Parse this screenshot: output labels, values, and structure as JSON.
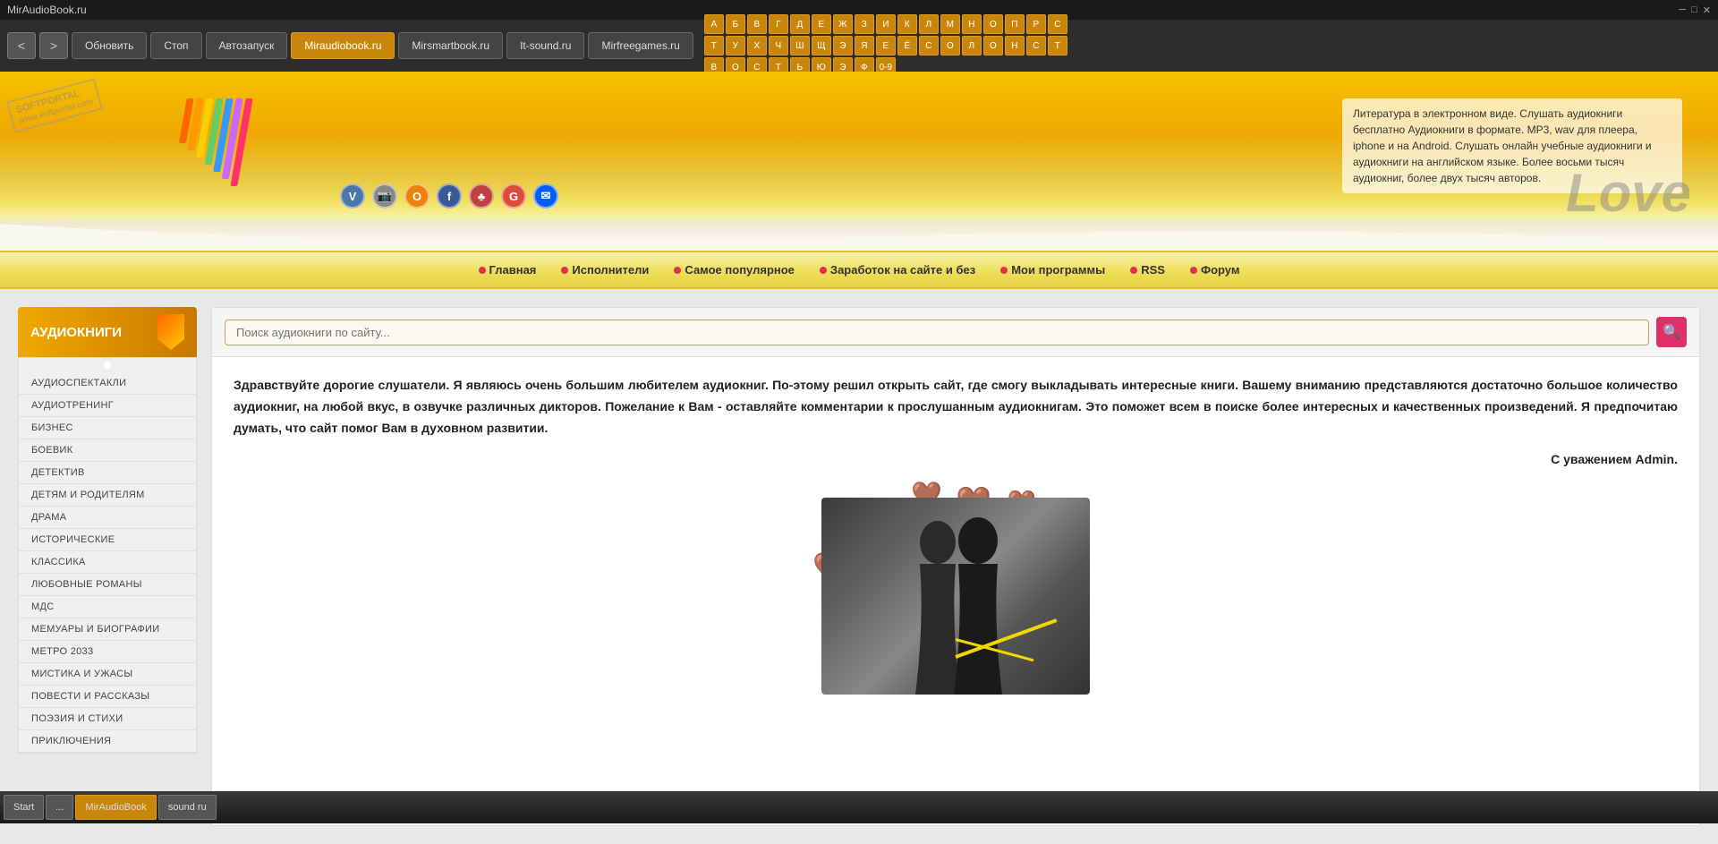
{
  "titleBar": {
    "title": "MirAudioBook.ru",
    "controls": [
      "─",
      "□",
      "✕"
    ]
  },
  "toolbar": {
    "backBtn": "<",
    "forwardBtn": ">",
    "refreshBtn": "Обновить",
    "stopBtn": "Стоп",
    "autorunBtn": "Автозапуск",
    "tabs": [
      {
        "label": "Miraudiobook.ru",
        "active": true
      },
      {
        "label": "Mirsmartbook.ru",
        "active": false
      },
      {
        "label": "It-sound.ru",
        "active": false
      },
      {
        "label": "Mirfreegames.ru",
        "active": false
      }
    ],
    "alphabet": [
      "А",
      "Б",
      "В",
      "Г",
      "Д",
      "Е",
      "Ж",
      "З",
      "И",
      "К",
      "Л",
      "М",
      "Н",
      "О",
      "П",
      "Р",
      "С",
      "Т",
      "У",
      "Х",
      "Ч",
      "Ш",
      "Щ",
      "Э",
      "Я",
      "Е",
      "Ё",
      "С",
      "О",
      "Л",
      "О",
      "Н",
      "С",
      "Т",
      "В",
      "О",
      "С",
      "Т",
      "Ь",
      "Ю",
      "Э",
      "Ф",
      "0-9"
    ]
  },
  "header": {
    "softportalText": "SOFTPORTAL\nwww.softportal.com",
    "descriptionText": "Литература в электронном виде. Слушать аудиокниги бесплатно Аудиокниги в формате. MP3, wav для плеера, iphone и на Android. Слушать онлайн учебные аудиокниги и аудиокниги на английском языке. Более восьми тысяч аудиокниг, более двух тысяч авторов.",
    "loveText": "Love",
    "socialIcons": [
      {
        "name": "vk",
        "color": "#4a76a8",
        "symbol": "V"
      },
      {
        "name": "camera",
        "color": "#888",
        "symbol": "📷"
      },
      {
        "name": "odnoklassniki",
        "color": "#ee8208",
        "symbol": "О"
      },
      {
        "name": "facebook",
        "color": "#3b5998",
        "symbol": "f"
      },
      {
        "name": "livejournal",
        "color": "#c04040",
        "symbol": "♣"
      },
      {
        "name": "google",
        "color": "#dd4b39",
        "symbol": "G"
      },
      {
        "name": "mail",
        "color": "#005ff9",
        "symbol": "✉"
      }
    ]
  },
  "navMenu": {
    "items": [
      "Главная",
      "Исполнители",
      "Самое популярное",
      "Заработок на сайте и без",
      "Мои программы",
      "RSS",
      "Форум"
    ]
  },
  "sidebar": {
    "headerLabel": "АУДИОКНИГИ",
    "items": [
      "АУДИОСПЕКТАКЛИ",
      "АУДИОТРЕНИНГ",
      "БИЗНЕС",
      "БОЕВИК",
      "ДЕТЕКТИВ",
      "ДЕТЯМ И РОДИТЕЛЯМ",
      "ДРАМА",
      "ИСТОРИЧЕСКИЕ",
      "КЛАССИКА",
      "ЛЮБОВНЫЕ РОМАНЫ",
      "МДС",
      "МЕМУАРЫ И БИОГРАФИИ",
      "МЕТРО 2033",
      "МИСТИКА И УЖАСЫ",
      "ПОВЕСТИ И РАССКАЗЫ",
      "ПОЭЗИЯ И СТИХИ",
      "ПРИКЛЮЧЕНИЯ"
    ]
  },
  "search": {
    "placeholder": "Поиск аудиокниги по сайту...",
    "buttonIcon": "🔍"
  },
  "welcomeText": {
    "body": "Здравствуйте дорогие слушатели. Я являюсь очень большим любителем аудиокниг. По-этому решил открыть сайт, где смогу выкладывать интересные книги. Вашему вниманию представляются достаточно большое количество аудиокниг, на любой вкус, в озвучке различных дикторов. Пожелание к Вам - оставляйте комментарии к прослушанным аудиокнигам. Это поможет всем в поиске более интересных и качественных произведений. Я предпочитаю думать, что сайт помог Вам в духовном развитии.",
    "signature": "С уважением Admin."
  },
  "taskbar": {
    "items": [
      {
        "label": "Start",
        "active": false
      },
      {
        "label": "...",
        "active": false
      },
      {
        "label": "MirAudioBook",
        "active": true
      },
      {
        "label": "sound ru",
        "active": false
      }
    ]
  },
  "colors": {
    "accent": "#f0a800",
    "activeTab": "#c8860a",
    "navDot": "#e0304a",
    "searchBtn": "#e0306a",
    "sidebarHeader": "#f0a800"
  },
  "stripes": [
    "#ff6600",
    "#ff9900",
    "#ffcc00",
    "#66cc66",
    "#3399ff",
    "#cc66ff",
    "#ff3366"
  ]
}
